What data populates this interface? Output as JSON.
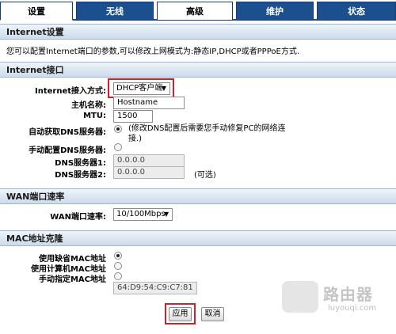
{
  "tabs": [
    {
      "label": "设置"
    },
    {
      "label": "无线"
    },
    {
      "label": "高级"
    },
    {
      "label": "维护"
    },
    {
      "label": "状态"
    }
  ],
  "internet_settings": {
    "title": "Internet设置",
    "description": "您可以配置Internet端口的参数,可以修改上网模式为:静态IP,DHCP或者PPPoE方式."
  },
  "internet_port": {
    "title": "Internet接口",
    "access_mode_label": "Internet接入方式:",
    "access_mode_value": "DHCP客户端",
    "hostname_label": "主机名称:",
    "hostname_value": "Hostname",
    "mtu_label": "MTU:",
    "mtu_value": "1500",
    "auto_dns_label": "自动获取DNS服务器:",
    "auto_dns_note": "(修改DNS配置后需要您手动修复PC的网络连接.)",
    "manual_dns_label": "手动配置DNS服务器:",
    "dns1_label": "DNS服务器1:",
    "dns1_value": "0.0.0.0",
    "dns2_label": "DNS服务器2:",
    "dns2_value": "0.0.0.0",
    "dns2_optional": "(可选)"
  },
  "wan_speed": {
    "title": "WAN端口速率",
    "label": "WAN端口速率:",
    "value": "10/100Mbps"
  },
  "mac_clone": {
    "title": "MAC地址克隆",
    "default_mac_label": "使用缺省MAC地址",
    "computer_mac_label": "使用计算机MAC地址",
    "manual_mac_label": "手动指定MAC地址",
    "manual_mac_value": "64:D9:54:C9:C7:81"
  },
  "actions": {
    "apply_label": "应用",
    "cancel_label": "取消"
  },
  "watermark": {
    "text": "路由器",
    "sub": "luyouqi.com"
  },
  "colors": {
    "tab_bg": "#1c4f8e",
    "highlight": "#d0202a"
  }
}
